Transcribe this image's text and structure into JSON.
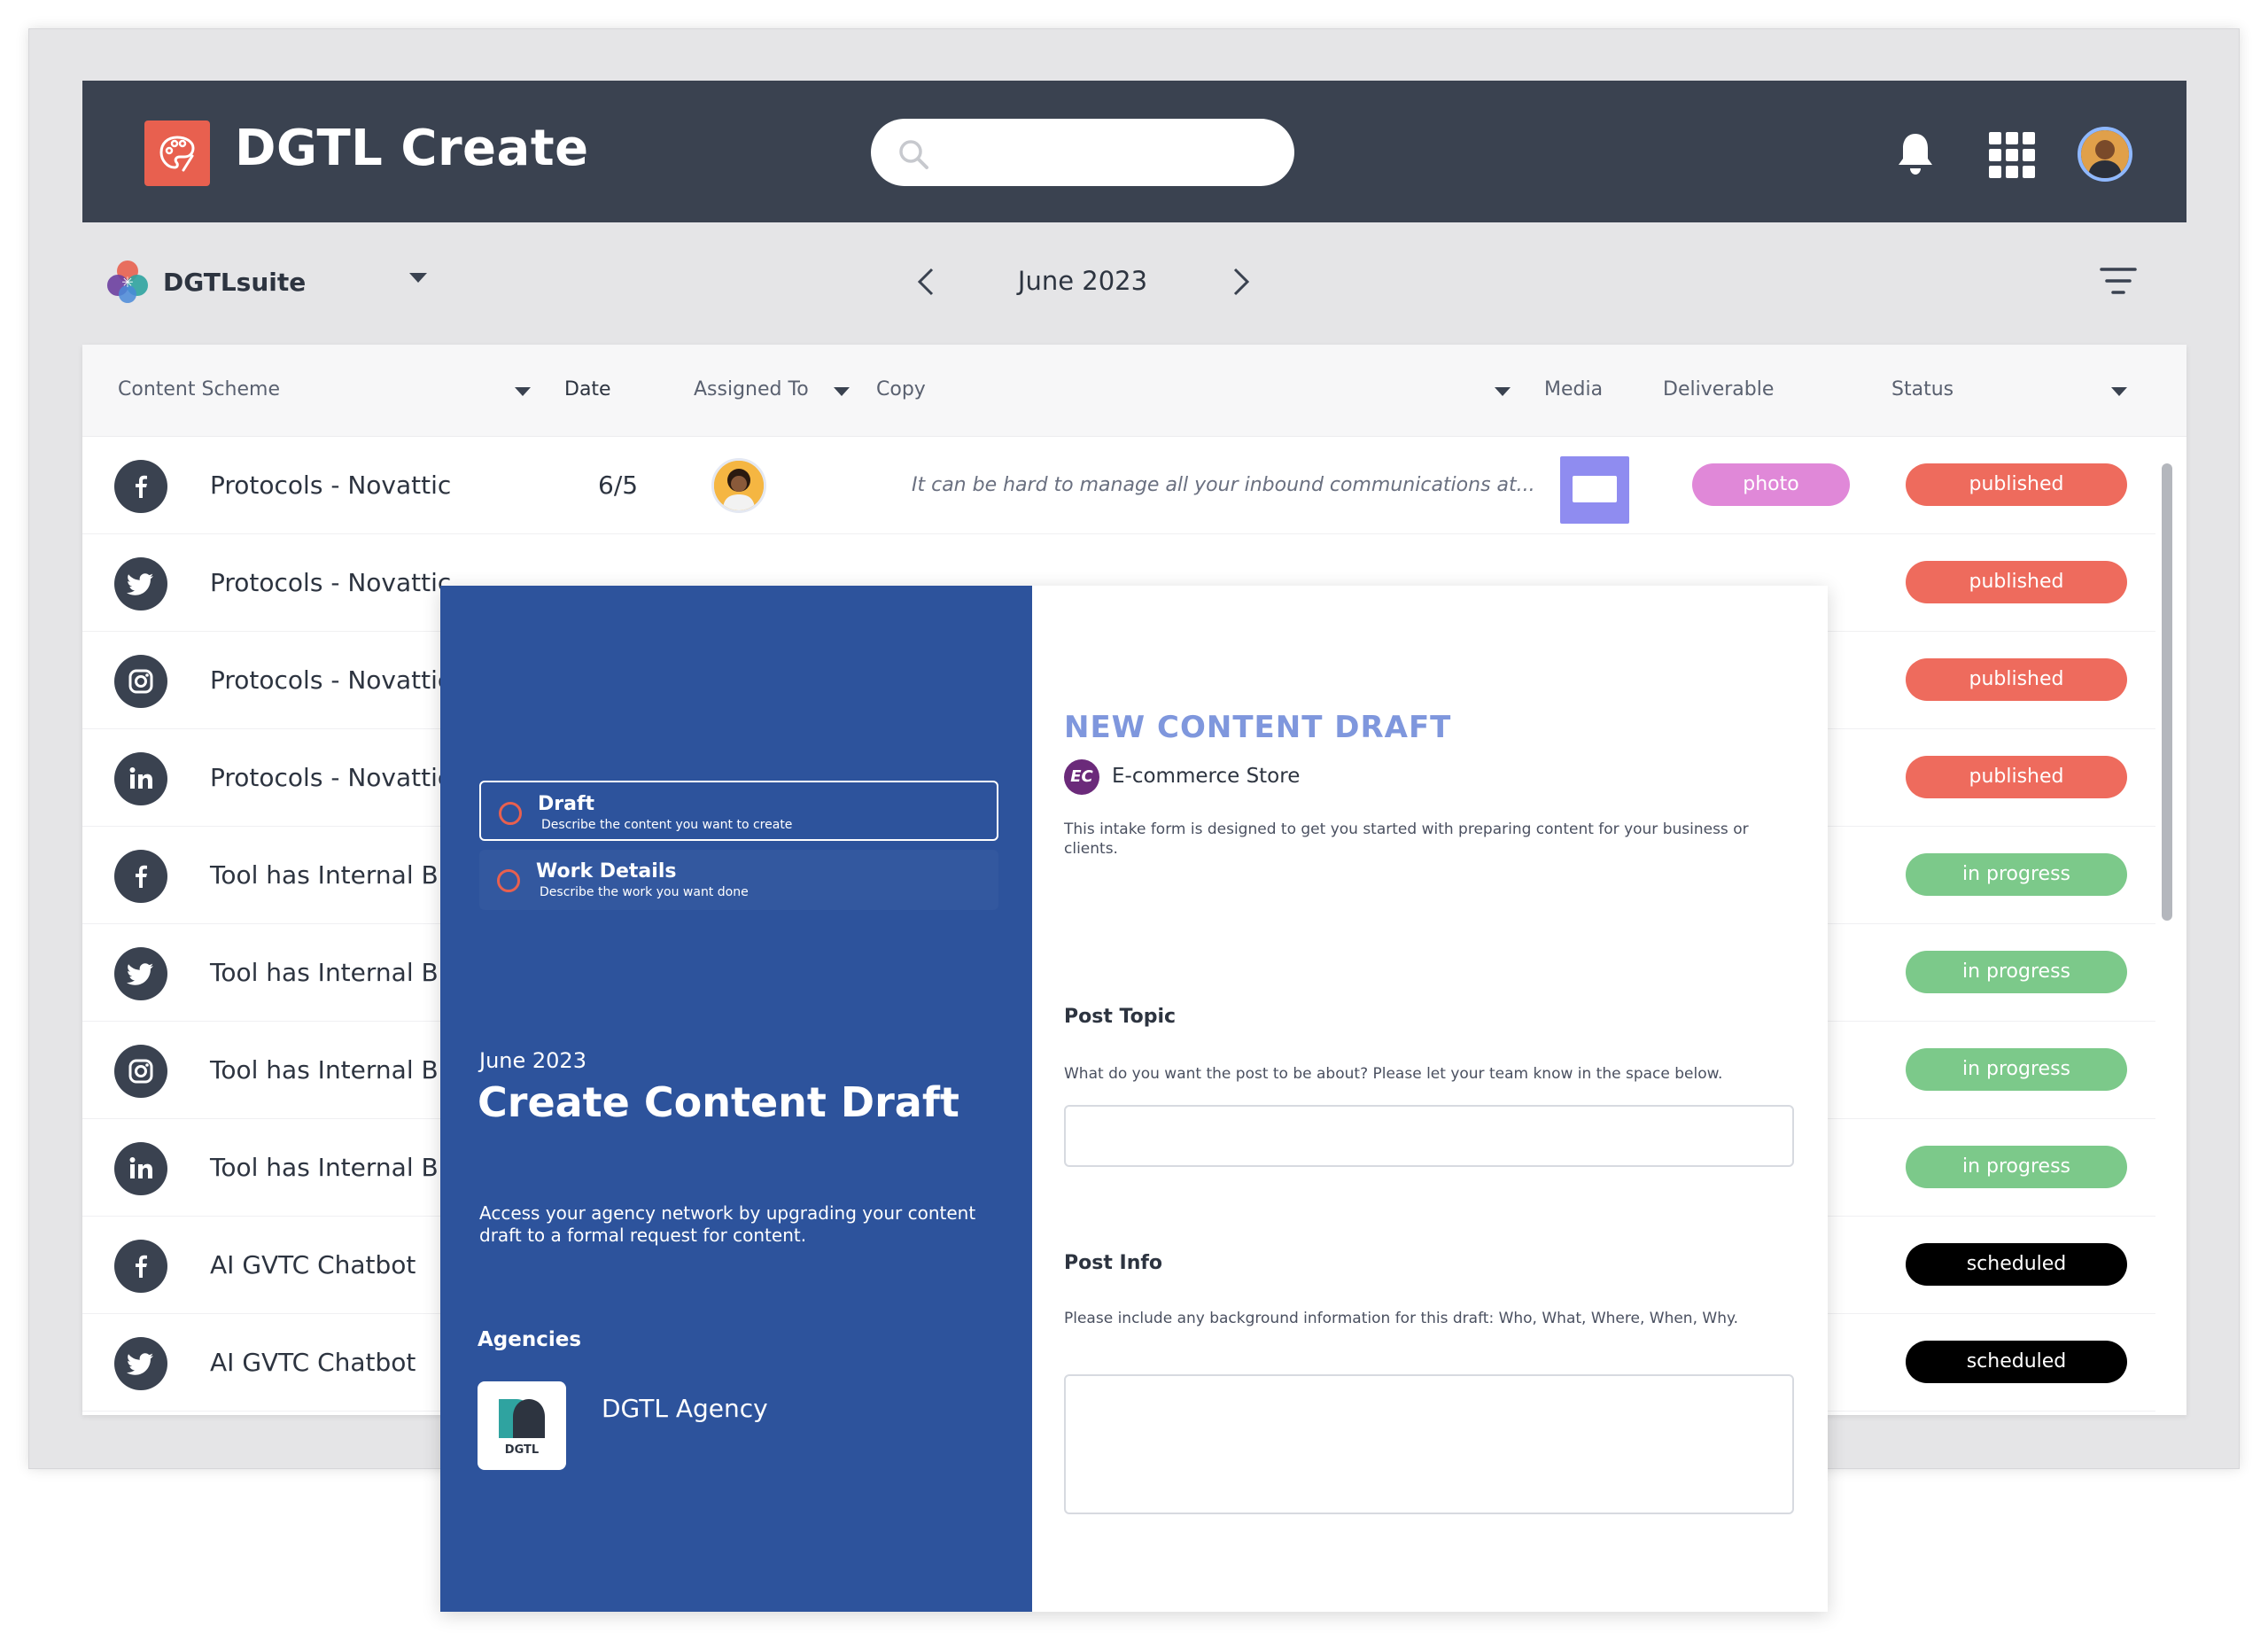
{
  "header": {
    "app_title": "DGTL Create",
    "search_placeholder": "",
    "icons": [
      "palette-icon",
      "search-icon",
      "bell-icon",
      "apps-grid-icon",
      "user-avatar"
    ]
  },
  "subbar": {
    "suite_name": "DGTLsuite",
    "month": "June 2023"
  },
  "table": {
    "columns": {
      "content_scheme": "Content Scheme",
      "date": "Date",
      "assigned_to": "Assigned To",
      "copy": "Copy",
      "media": "Media",
      "deliverable": "Deliverable",
      "status": "Status"
    },
    "rows": [
      {
        "network": "facebook",
        "scheme": "Protocols - Novattic",
        "date": "6/5",
        "copy": "It can be hard to manage all your inbound communications at...",
        "deliverable": "photo",
        "status": "published"
      },
      {
        "network": "twitter",
        "scheme": "Protocols - Novattic",
        "date": "",
        "copy": "",
        "deliverable": "",
        "status": "published"
      },
      {
        "network": "instagram",
        "scheme": "Protocols - Novattic",
        "date": "",
        "copy": "",
        "deliverable": "",
        "status": "published"
      },
      {
        "network": "linkedin",
        "scheme": "Protocols - Novattic",
        "date": "",
        "copy": "",
        "deliverable": "",
        "status": "published"
      },
      {
        "network": "facebook",
        "scheme": "Tool has Internal B",
        "date": "",
        "copy": "",
        "deliverable": "",
        "status": "in progress"
      },
      {
        "network": "twitter",
        "scheme": "Tool has Internal B",
        "date": "",
        "copy": "",
        "deliverable": "",
        "status": "in progress"
      },
      {
        "network": "instagram",
        "scheme": "Tool has Internal B",
        "date": "",
        "copy": "",
        "deliverable": "",
        "status": "in progress"
      },
      {
        "network": "linkedin",
        "scheme": "Tool has Internal B",
        "date": "",
        "copy": "",
        "deliverable": "",
        "status": "in progress"
      },
      {
        "network": "facebook",
        "scheme": "AI GVTC Chatbot",
        "date": "",
        "copy": "",
        "deliverable": "",
        "status": "scheduled"
      },
      {
        "network": "twitter",
        "scheme": "AI GVTC Chatbot",
        "date": "",
        "copy": "",
        "deliverable": "",
        "status": "scheduled"
      }
    ]
  },
  "colors": {
    "header_bg": "#3a4250",
    "brand_accent": "#e8604f",
    "published": "#ee6b5d",
    "in_progress": "#7cc98a",
    "scheduled": "#000000",
    "photo": "#e088d8",
    "status_dark": "#3a4250",
    "modal_left": "#2d539c",
    "form_heading": "#7f97dd"
  },
  "modal": {
    "steps": [
      {
        "title": "Draft",
        "subtitle": "Describe the content you want to create"
      },
      {
        "title": "Work Details",
        "subtitle": "Describe the work you want done"
      }
    ],
    "month": "June 2023",
    "title": "Create Content Draft",
    "description": "Access your agency network by upgrading your content draft to a formal request for content.",
    "agencies_label": "Agencies",
    "agency_name": "DGTL Agency",
    "agency_logo_text": "DGTL",
    "form": {
      "heading": "NEW CONTENT DRAFT",
      "badge": "EC",
      "store": "E-commerce Store",
      "intro": "This intake form is designed to get you started with preparing content for your business or clients.",
      "post_topic_label": "Post Topic",
      "post_topic_help": "What do you want the post to be about? Please let your team know in the space below.",
      "post_topic_value": "",
      "post_info_label": "Post Info",
      "post_info_help": "Please include any background information for this draft: Who, What, Where, When, Why.",
      "post_info_value": ""
    }
  }
}
